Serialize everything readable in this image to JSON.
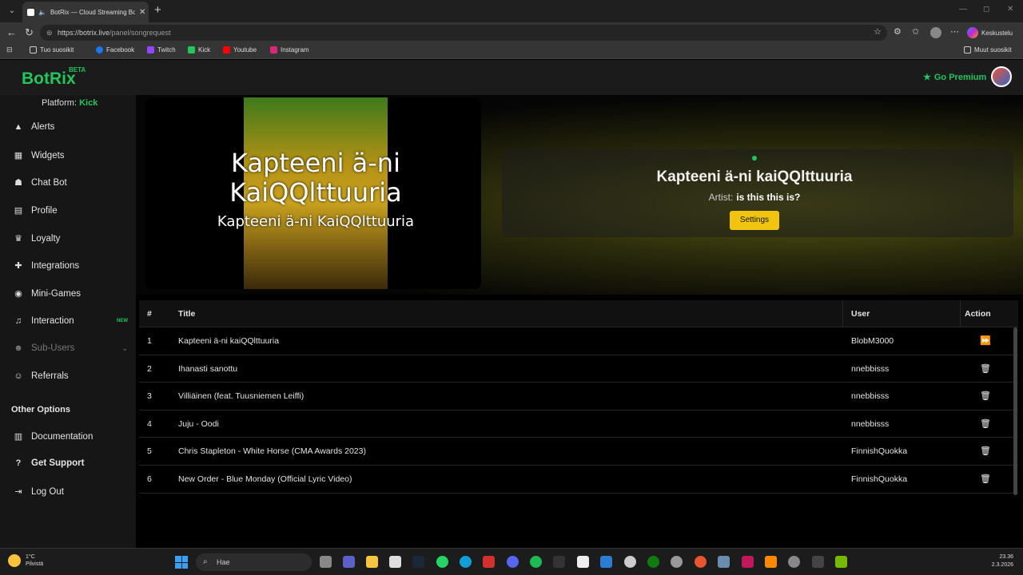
{
  "browser": {
    "tab_title": "BotRix — Cloud Streaming Bo",
    "url_host": "https://botrix.live",
    "url_path": "/panel/songrequest",
    "copilot_label": "Keskustelu",
    "bookmarks": [
      "Tuo suosikit",
      "Facebook",
      "Twitch",
      "Kick",
      "Youtube",
      "Instagram"
    ],
    "other_bookmarks": "Muut suosikit"
  },
  "header": {
    "logo": "BotRix",
    "beta": "BETA",
    "premium_label": "Go Premium"
  },
  "sidebar": {
    "platform_label": "Platform:",
    "platform_value": "Kick",
    "items": [
      {
        "label": "Alerts",
        "icon": "warning-icon"
      },
      {
        "label": "Widgets",
        "icon": "widgets-icon"
      },
      {
        "label": "Chat Bot",
        "icon": "robot-icon"
      },
      {
        "label": "Profile",
        "icon": "profile-card-icon"
      },
      {
        "label": "Loyalty",
        "icon": "trophy-icon"
      },
      {
        "label": "Integrations",
        "icon": "puzzle-icon"
      },
      {
        "label": "Mini-Games",
        "icon": "gamepad-icon"
      },
      {
        "label": "Interaction",
        "icon": "music-icon",
        "badge": "NEW"
      },
      {
        "label": "Sub-Users",
        "icon": "users-icon"
      },
      {
        "label": "Referrals",
        "icon": "referrals-icon"
      }
    ],
    "other_options_heading": "Other Options",
    "other_items": [
      {
        "label": "Documentation",
        "icon": "book-icon"
      },
      {
        "label": "Get Support",
        "icon": "question-icon"
      },
      {
        "label": "Log Out",
        "icon": "logout-icon"
      }
    ]
  },
  "now_playing": {
    "video_overlay_line1": "Kapteeni ä-ni KaiQQlttuuria",
    "video_overlay_line2": "Kapteeni ä-ni KaiQQlttuuria",
    "title": "Kapteeni ä-ni kaiQQlttuuria",
    "artist_label": "Artist:",
    "artist_value": "is this this is?",
    "settings_label": "Settings"
  },
  "queue": {
    "headers": {
      "num": "#",
      "title": "Title",
      "user": "User",
      "action": "Action"
    },
    "rows": [
      {
        "num": "1",
        "title": "Kapteeni ä-ni kaiQQlttuuria",
        "user": "BlobM3000",
        "action": "skip"
      },
      {
        "num": "2",
        "title": "Ihanasti sanottu",
        "user": "nnebbisss",
        "action": "delete"
      },
      {
        "num": "3",
        "title": "Villiäinen (feat. Tuusniemen Leiffi)",
        "user": "nnebbisss",
        "action": "delete"
      },
      {
        "num": "4",
        "title": "Juju - Oodi",
        "user": "nnebbisss",
        "action": "delete"
      },
      {
        "num": "5",
        "title": "Chris Stapleton - White Horse (CMA Awards 2023)",
        "user": "FinnishQuokka",
        "action": "delete"
      },
      {
        "num": "6",
        "title": "New Order - Blue Monday (Official Lyric Video)",
        "user": "FinnishQuokka",
        "action": "delete"
      }
    ]
  },
  "taskbar": {
    "weather_temp": "1°C",
    "weather_desc": "Pilvistä",
    "search_placeholder": "Hae",
    "time": "23.36",
    "date": "2.3.2026"
  },
  "colors": {
    "accent": "#22c55e",
    "settings_button": "#f1c40f"
  }
}
